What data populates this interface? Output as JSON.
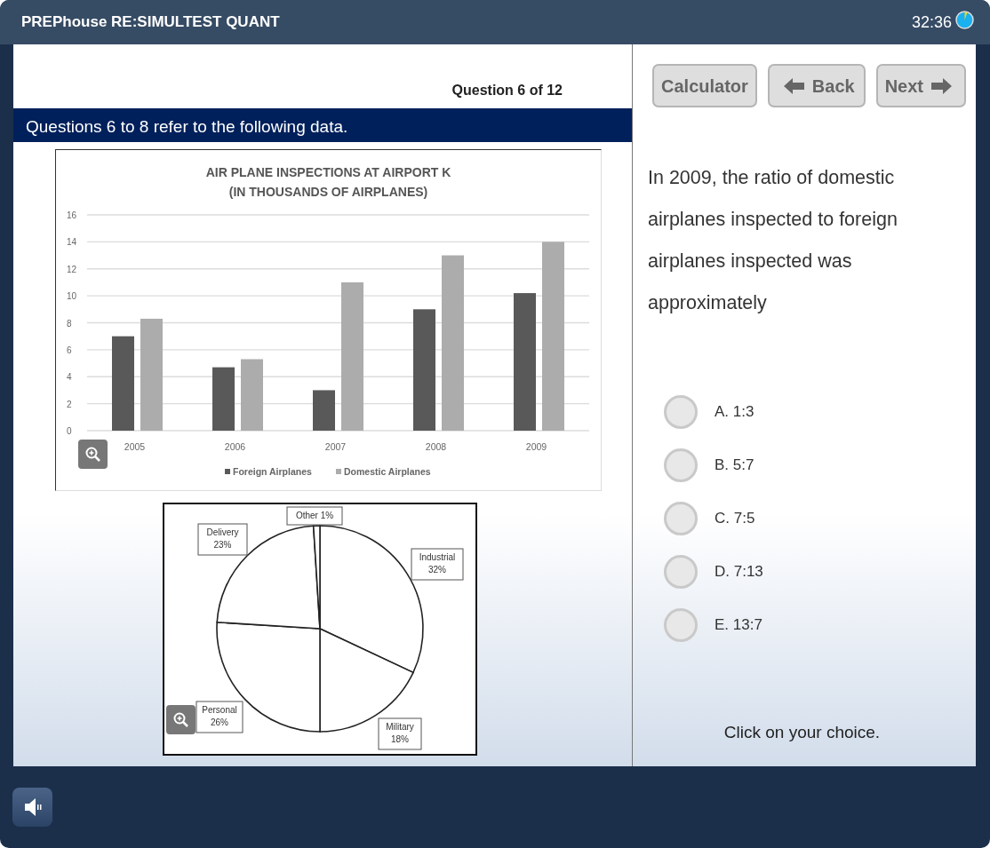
{
  "window": {
    "title": "PREPhouse RE:SIMULTEST QUANT",
    "timer": "32:36"
  },
  "toolbar": [
    {
      "label": "Calculator",
      "kind": "plain"
    },
    {
      "label": "Back",
      "kind": "back"
    },
    {
      "label": "Next",
      "kind": "next"
    }
  ],
  "question": {
    "counter": "Question 6 of 12",
    "banner": "Questions 6 to 8 refer to the following data.",
    "stem": "In 2009, the ratio of domestic airplanes inspected to foreign airplanes inspected was approximately",
    "choices": [
      {
        "label": "A. 1:3",
        "selected": false
      },
      {
        "label": "B. 5:7",
        "selected": false
      },
      {
        "label": "C. 7:5",
        "selected": false
      },
      {
        "label": "D. 7:13",
        "selected": false
      },
      {
        "label": "E. 13:7",
        "selected": false
      }
    ],
    "instruction": "Click on your choice."
  },
  "figures": [
    {
      "chart_data": {
        "type": "bar",
        "title": "AIR PLANE INSPECTIONS AT AIRPORT K\n(IN THOUSANDS OF AIRPLANES)",
        "categories": [
          "2005",
          "2006",
          "2007",
          "2008",
          "2009"
        ],
        "series": [
          {
            "name": "Foreign Airplanes",
            "color": "#595959",
            "values": [
              7,
              4.7,
              3,
              9,
              10.2
            ]
          },
          {
            "name": "Domestic Airplanes",
            "color": "#acacac",
            "values": [
              8.3,
              5.3,
              11,
              13,
              14
            ]
          }
        ],
        "ylim": [
          0,
          16
        ],
        "yticks": [
          0,
          2,
          4,
          6,
          8,
          10,
          12,
          14,
          16
        ],
        "grid": true,
        "legend": "bottom"
      }
    },
    {
      "chart_data": {
        "type": "pie",
        "values": [
          32,
          18,
          26,
          23,
          1
        ],
        "value_labels": [
          "Industrial\n32%",
          "Military\n18%",
          "Personal\n26%",
          "Delivery\n23%",
          "Other 1%"
        ]
      }
    }
  ]
}
